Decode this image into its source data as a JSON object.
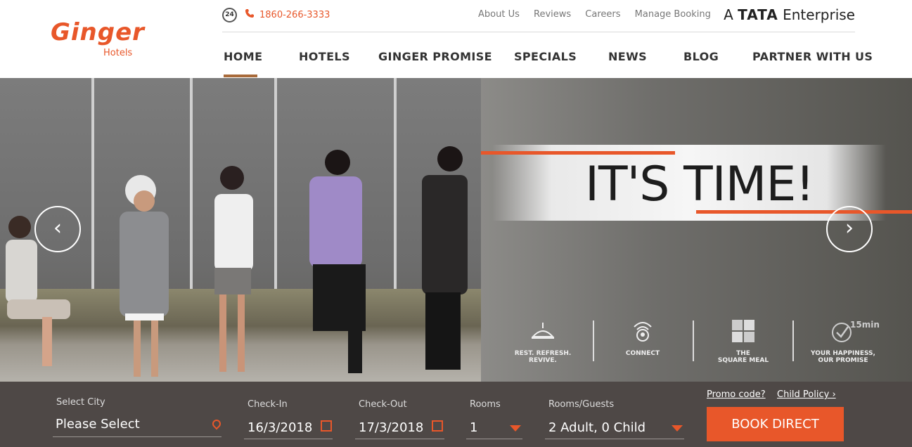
{
  "brand": {
    "name": "Ginger",
    "sub": "Hotels",
    "tata": "A TATA Enterprise",
    "tata_prefix": "A",
    "tata_mark": "TATA",
    "tata_suffix": "Enterprise"
  },
  "topbar": {
    "clock_label": "24",
    "phone": "1860-266-3333",
    "links": [
      "About Us",
      "Reviews",
      "Careers",
      "Manage Booking"
    ]
  },
  "nav": {
    "items": [
      "HOME",
      "HOTELS",
      "GINGER PROMISE",
      "SPECIALS",
      "NEWS",
      "BLOG",
      "PARTNER WITH US"
    ],
    "active": "HOME"
  },
  "hero": {
    "headline": "IT'S TIME!",
    "features": [
      {
        "label1": "REST. REFRESH.",
        "label2": "REVIVE.",
        "icon": "rest-icon"
      },
      {
        "label1": "CONNECT",
        "label2": "",
        "icon": "wifi-location-icon"
      },
      {
        "label1": "THE",
        "label2": "SQUARE MEAL",
        "icon": "meal-icon"
      },
      {
        "label1": "YOUR HAPPINESS,",
        "label2": "OUR PROMISE",
        "icon": "15min-icon",
        "badge": "15min"
      }
    ],
    "prev_arrow": "‹",
    "next_arrow": "›"
  },
  "booking": {
    "city_label": "Select City",
    "city_value": "Please Select",
    "checkin_label": "Check-In",
    "checkin_value": "16/3/2018",
    "checkout_label": "Check-Out",
    "checkout_value": "17/3/2018",
    "rooms_label": "Rooms",
    "rooms_value": "1",
    "guests_label": "Rooms/Guests",
    "guests_value": "2 Adult, 0 Child",
    "promo_label": "Promo code?",
    "child_policy_label": "Child Policy ›",
    "book_button": "BOOK DIRECT"
  },
  "colors": {
    "accent": "#e8572a",
    "nav_underline": "#a86a3a",
    "booking_bg": "#443e3c"
  }
}
